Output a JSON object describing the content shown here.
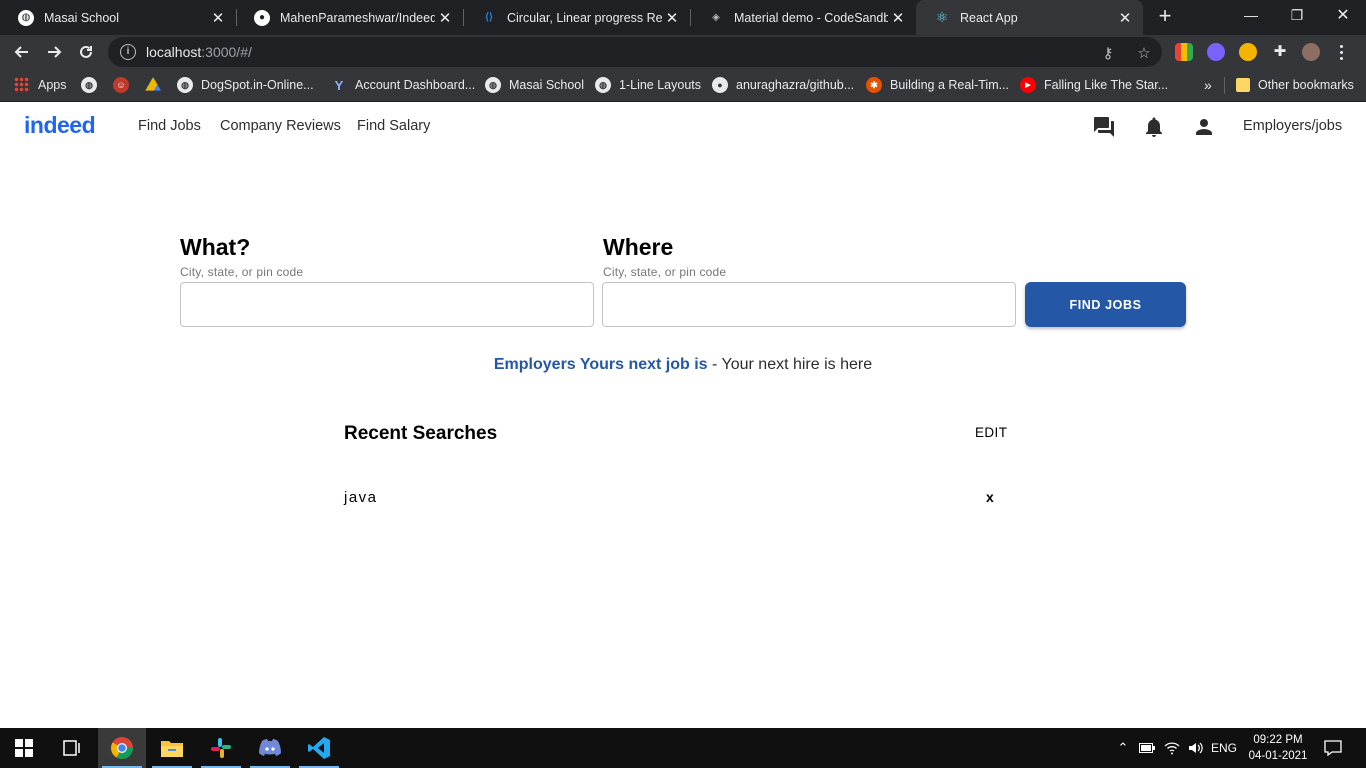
{
  "browser": {
    "tabs": [
      {
        "title": "Masai School",
        "icon": "globe-icon"
      },
      {
        "title": "MahenParameshwar/IndeedRe",
        "icon": "github-icon"
      },
      {
        "title": "Circular, Linear progress React",
        "icon": "material-ui-icon"
      },
      {
        "title": "Material demo - CodeSandbox",
        "icon": "codesandbox-icon"
      },
      {
        "title": "React App",
        "icon": "react-icon"
      }
    ],
    "active_tab": 4,
    "url_host": "localhost",
    "url_path": ":3000/#/",
    "bookmarks": [
      {
        "label": "Apps",
        "icon": "apps-grid-icon"
      },
      {
        "label": "",
        "icon": "globe-icon"
      },
      {
        "label": "",
        "icon": "person-icon"
      },
      {
        "label": "",
        "icon": "google-drive-icon"
      },
      {
        "label": "DogSpot.in-Online...",
        "icon": "globe-icon"
      },
      {
        "label": "Account Dashboard...",
        "icon": "vercel-icon"
      },
      {
        "label": "Masai School",
        "icon": "globe-icon"
      },
      {
        "label": "1-Line Layouts",
        "icon": "globe-icon"
      },
      {
        "label": "anuraghazra/github...",
        "icon": "github-icon"
      },
      {
        "label": "Building a Real-Tim...",
        "icon": "orange-logo-icon"
      },
      {
        "label": "Falling Like The Star...",
        "icon": "youtube-icon"
      }
    ],
    "overflow_label": "»",
    "other_bookmarks": "Other bookmarks"
  },
  "app": {
    "logo": "indeed",
    "nav": [
      "Find Jobs",
      "Company Reviews",
      "Find Salary"
    ],
    "employers_link": "Employers/jobs",
    "accent_color": "#2557a7"
  },
  "search": {
    "what_title": "What?",
    "what_hint": "City, state, or pin code",
    "what_value": "",
    "where_title": "Where",
    "where_hint": "City, state, or pin code",
    "where_value": "",
    "button": "FIND JOBS"
  },
  "tagline": {
    "strong": "Employers Yours next job is",
    "separator": " - ",
    "rest": "Your next hire is here"
  },
  "recent": {
    "title": "Recent Searches",
    "edit": "EDIT",
    "items": [
      {
        "query": "java",
        "remove": "x"
      }
    ]
  },
  "taskbar": {
    "apps": [
      "task-view-icon",
      "chrome-icon",
      "file-explorer-icon",
      "slack-icon",
      "discord-icon",
      "vscode-icon"
    ],
    "language": "ENG",
    "time": "09:22 PM",
    "date": "04-01-2021"
  }
}
